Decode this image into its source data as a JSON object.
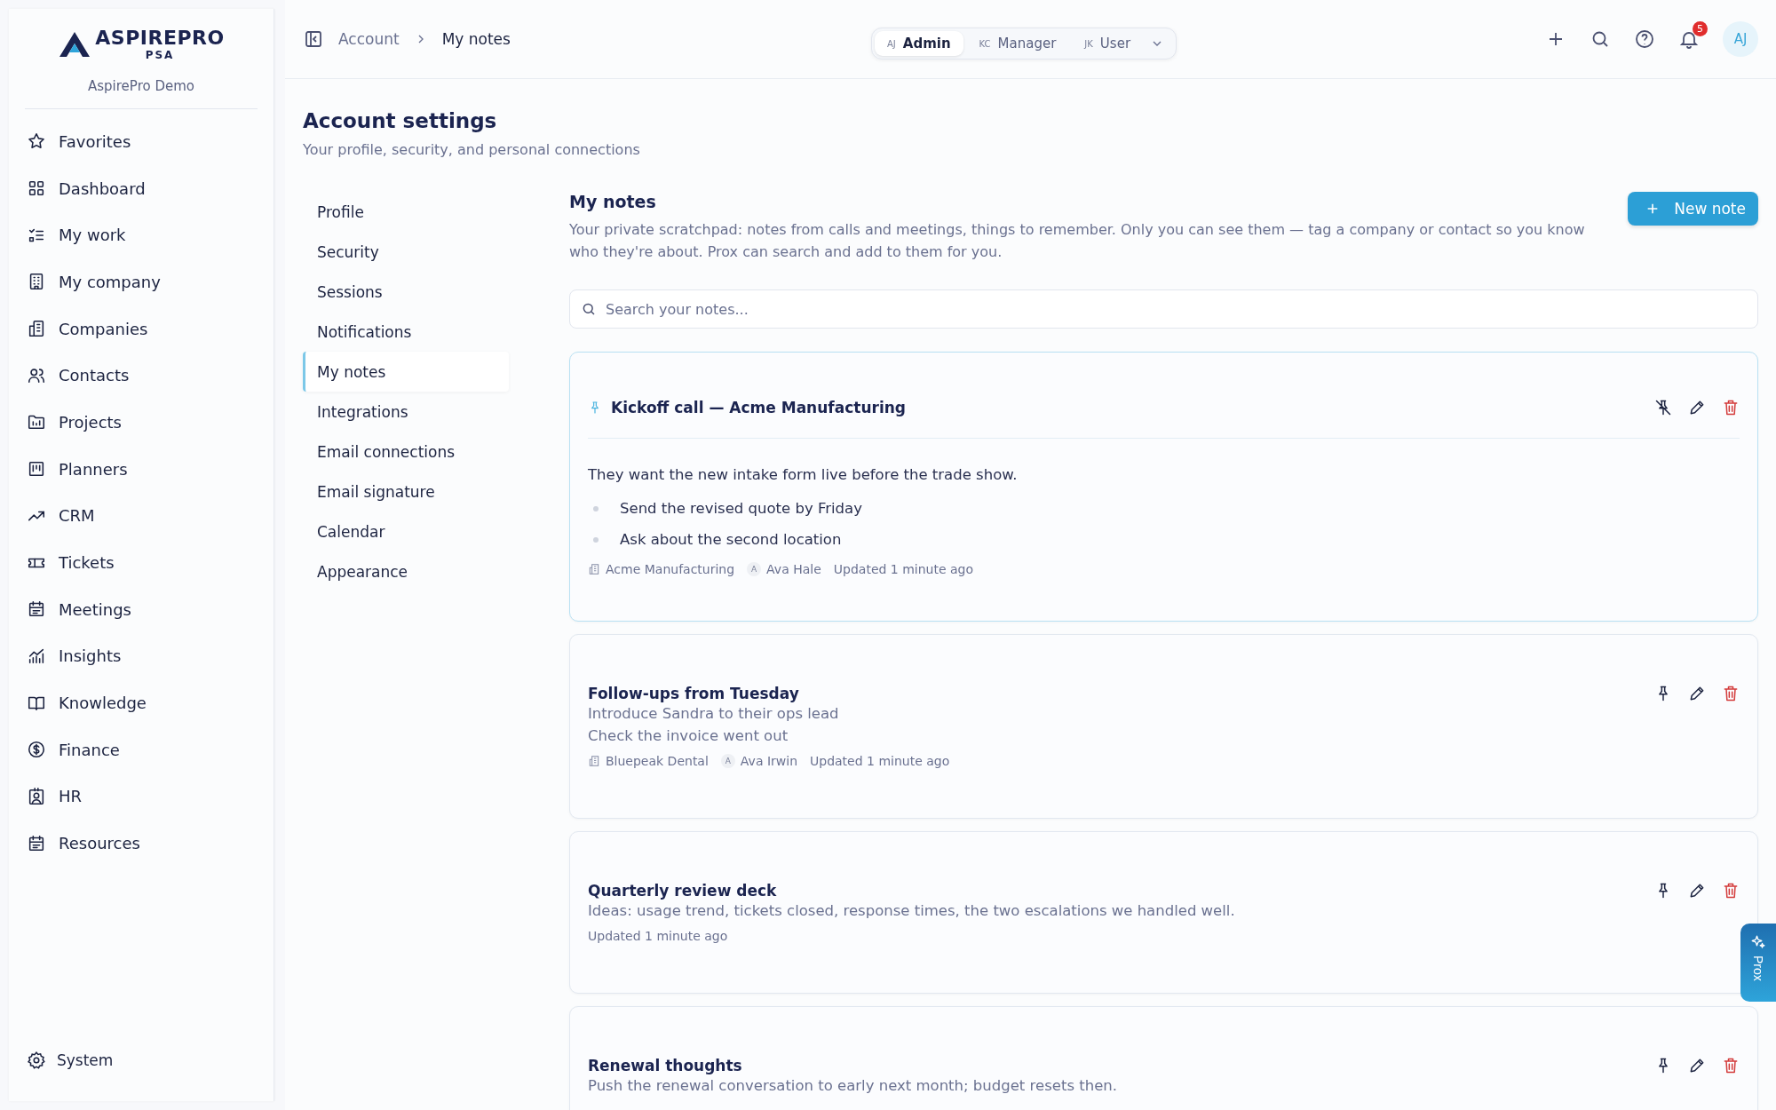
{
  "sidebar": {
    "logo": {
      "name": "ASPIREPRO",
      "sub": "PSA"
    },
    "org": "AspirePro Demo",
    "items": [
      {
        "label": "Favorites",
        "kind": "star"
      },
      {
        "label": "Dashboard",
        "kind": "grid"
      },
      {
        "label": "My work",
        "kind": "checklist"
      },
      {
        "label": "My company",
        "kind": "building"
      },
      {
        "label": "Companies",
        "kind": "buildings"
      },
      {
        "label": "Contacts",
        "kind": "people"
      },
      {
        "label": "Projects",
        "kind": "folder"
      },
      {
        "label": "Planners",
        "kind": "board"
      },
      {
        "label": "CRM",
        "kind": "trend"
      },
      {
        "label": "Tickets",
        "kind": "ticket"
      },
      {
        "label": "Meetings",
        "kind": "calendar"
      },
      {
        "label": "Insights",
        "kind": "chart"
      },
      {
        "label": "Knowledge",
        "kind": "book"
      },
      {
        "label": "Finance",
        "kind": "dollar"
      },
      {
        "label": "HR",
        "kind": "badge"
      },
      {
        "label": "Resources",
        "kind": "calendar"
      }
    ],
    "footer": "System"
  },
  "header": {
    "breadcrumbs": [
      "Account",
      "My notes"
    ],
    "roles": [
      {
        "initials": "AJ",
        "label": "Admin",
        "selected": true
      },
      {
        "initials": "KC",
        "label": "Manager",
        "selected": false
      },
      {
        "initials": "JK",
        "label": "User",
        "selected": false
      }
    ],
    "notification_count": "5",
    "avatar": "AJ"
  },
  "page": {
    "title": "Account settings",
    "subtitle": "Your profile, security, and personal connections"
  },
  "settings_nav": [
    {
      "label": "Profile",
      "selected": false
    },
    {
      "label": "Security",
      "selected": false
    },
    {
      "label": "Sessions",
      "selected": false
    },
    {
      "label": "Notifications",
      "selected": false
    },
    {
      "label": "My notes",
      "selected": true
    },
    {
      "label": "Integrations",
      "selected": false
    },
    {
      "label": "Email connections",
      "selected": false
    },
    {
      "label": "Email signature",
      "selected": false
    },
    {
      "label": "Calendar",
      "selected": false
    },
    {
      "label": "Appearance",
      "selected": false
    }
  ],
  "notes_panel": {
    "title": "My notes",
    "description": "Your private scratchpad: notes from calls and meetings, things to remember. Only you can see them — tag a company or contact so you know who they're about. Prox can search and add to them for you.",
    "new_button": "New note",
    "search": {
      "placeholder": "Search your notes..."
    },
    "notes": [
      {
        "title": "Kickoff call — Acme Manufacturing",
        "pinned": true,
        "lines": [
          "They want the new intake form live before the trade show."
        ],
        "bullets": [
          "Send the revised quote by Friday",
          "Ask about the second location"
        ],
        "company": "Acme Manufacturing",
        "contact": {
          "initial": "A",
          "name": "Ava Hale"
        },
        "updated": "Updated 1 minute ago"
      },
      {
        "title": "Follow-ups from Tuesday",
        "pinned": false,
        "lines": [
          "Introduce Sandra to their ops lead",
          "Check the invoice went out"
        ],
        "company": "Bluepeak Dental",
        "contact": {
          "initial": "A",
          "name": "Ava Irwin"
        },
        "updated": "Updated 1 minute ago"
      },
      {
        "title": "Quarterly review deck",
        "pinned": false,
        "lines": [
          "Ideas: usage trend, tickets closed, response times, the two escalations we handled well."
        ],
        "updated": "Updated 1 minute ago"
      },
      {
        "title": "Renewal thoughts",
        "pinned": false,
        "lines": [
          "Push the renewal conversation to early next month; budget resets then."
        ]
      }
    ]
  },
  "assistant_tab": {
    "label": "Prox"
  }
}
